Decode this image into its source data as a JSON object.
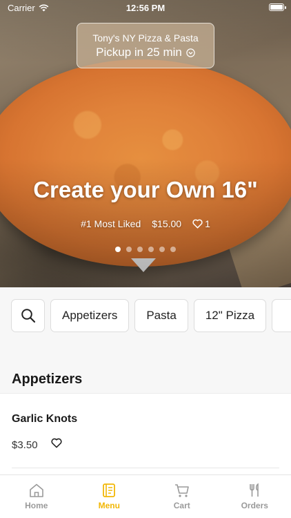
{
  "status_bar": {
    "carrier": "Carrier",
    "time": "12:56 PM"
  },
  "store": {
    "name": "Tony's NY Pizza & Pasta",
    "pickup": "Pickup in 25 min"
  },
  "hero": {
    "title": "Create your Own 16\"",
    "badge": "#1 Most Liked",
    "price": "$15.00",
    "likes": "1",
    "slide_count": 6,
    "active_slide": 1
  },
  "categories": {
    "items": [
      "Appetizers",
      "Pasta",
      "12\" Pizza"
    ]
  },
  "menu": {
    "section_title": "Appetizers",
    "items": [
      {
        "name": "Garlic Knots",
        "price": "$3.50"
      }
    ]
  },
  "tabs": [
    {
      "label": "Home",
      "icon": "home-icon"
    },
    {
      "label": "Menu",
      "icon": "menu-book-icon",
      "active": true
    },
    {
      "label": "Cart",
      "icon": "cart-icon"
    },
    {
      "label": "Orders",
      "icon": "fork-knife-icon"
    }
  ],
  "colors": {
    "accent": "#f2b705",
    "inactive": "#9a9a9a"
  }
}
